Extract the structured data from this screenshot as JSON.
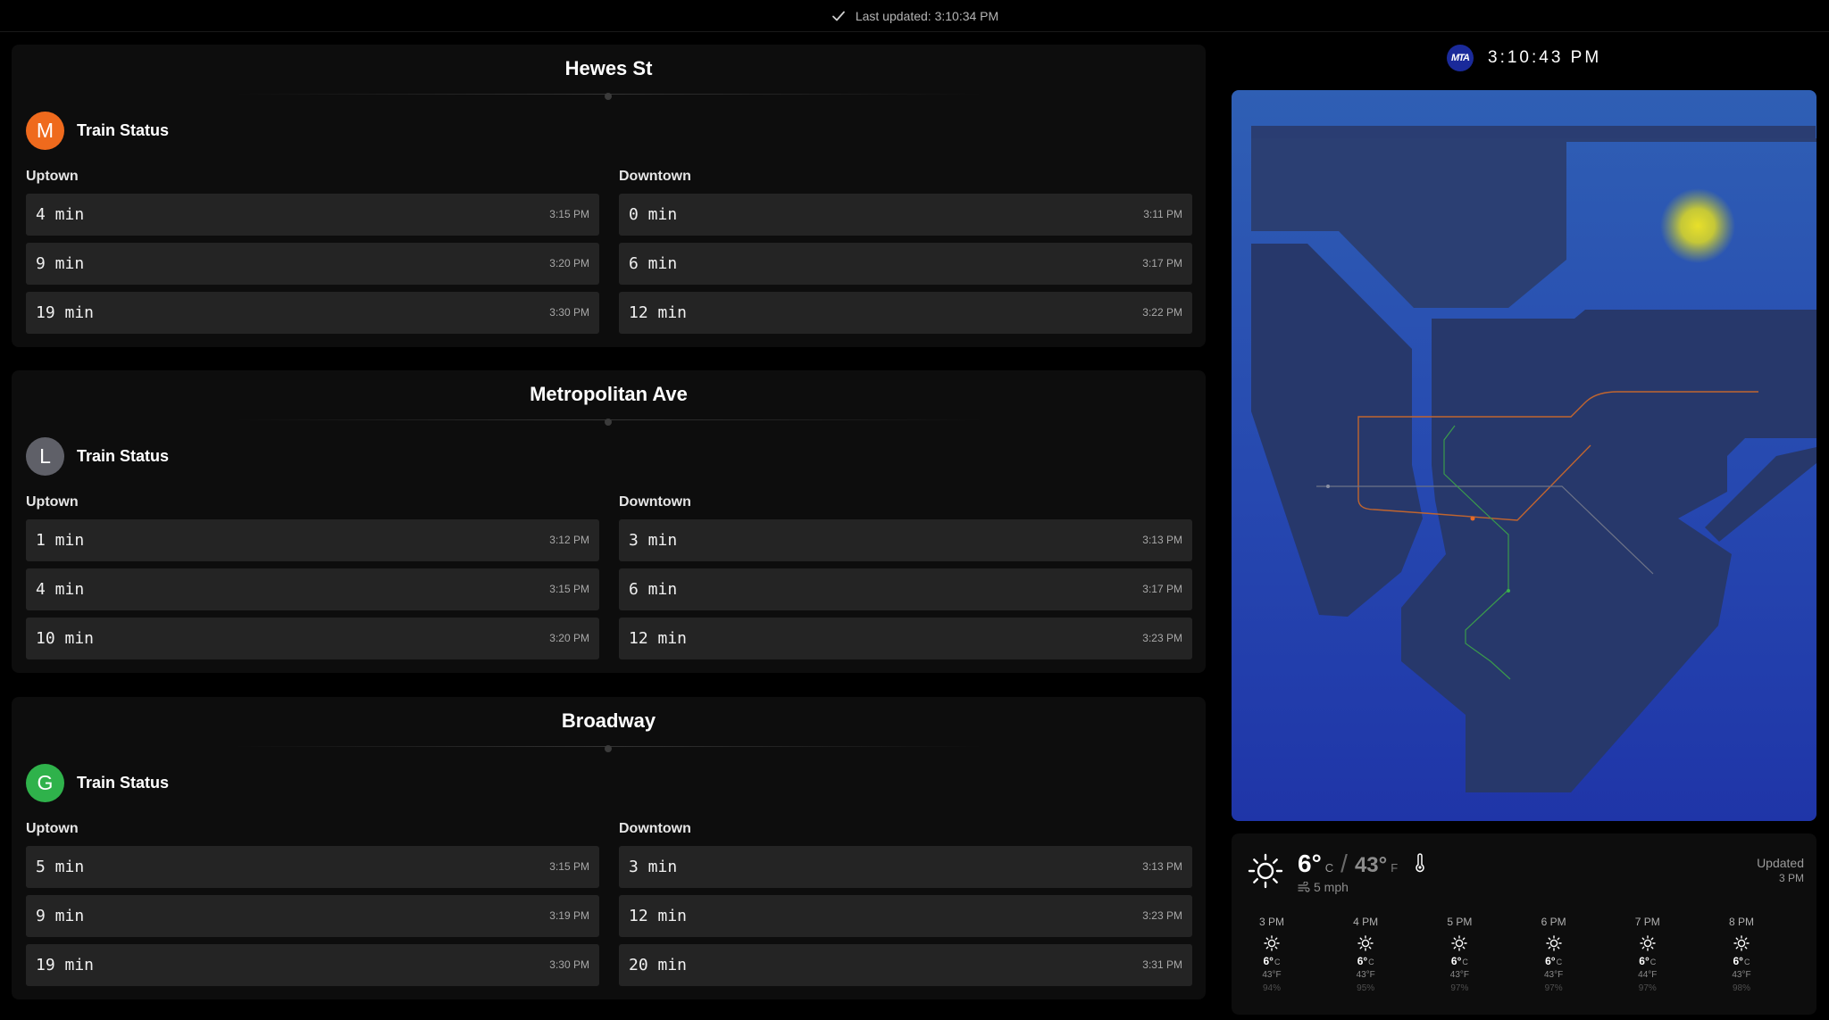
{
  "header": {
    "last_updated": "Last updated: 3:10:34 PM"
  },
  "clock": {
    "logo": "MTA",
    "time": "3:10:43 PM"
  },
  "stations": [
    {
      "name": "Hewes St",
      "line": "M",
      "line_color": "#ef6a1d",
      "status_label": "Train Status",
      "uptown_label": "Uptown",
      "downtown_label": "Downtown",
      "uptown": [
        {
          "mins": "4 min",
          "time": "3:15 PM"
        },
        {
          "mins": "9 min",
          "time": "3:20 PM"
        },
        {
          "mins": "19 min",
          "time": "3:30 PM"
        }
      ],
      "downtown": [
        {
          "mins": "0 min",
          "time": "3:11 PM"
        },
        {
          "mins": "6 min",
          "time": "3:17 PM"
        },
        {
          "mins": "12 min",
          "time": "3:22 PM"
        }
      ]
    },
    {
      "name": "Metropolitan Ave",
      "line": "L",
      "line_color": "#5f6068",
      "status_label": "Train Status",
      "uptown_label": "Uptown",
      "downtown_label": "Downtown",
      "uptown": [
        {
          "mins": "1 min",
          "time": "3:12 PM"
        },
        {
          "mins": "4 min",
          "time": "3:15 PM"
        },
        {
          "mins": "10 min",
          "time": "3:20 PM"
        }
      ],
      "downtown": [
        {
          "mins": "3 min",
          "time": "3:13 PM"
        },
        {
          "mins": "6 min",
          "time": "3:17 PM"
        },
        {
          "mins": "12 min",
          "time": "3:23 PM"
        }
      ]
    },
    {
      "name": "Broadway",
      "line": "G",
      "line_color": "#2fb24b",
      "status_label": "Train Status",
      "uptown_label": "Uptown",
      "downtown_label": "Downtown",
      "uptown": [
        {
          "mins": "5 min",
          "time": "3:15 PM"
        },
        {
          "mins": "9 min",
          "time": "3:19 PM"
        },
        {
          "mins": "19 min",
          "time": "3:30 PM"
        }
      ],
      "downtown": [
        {
          "mins": "3 min",
          "time": "3:13 PM"
        },
        {
          "mins": "12 min",
          "time": "3:23 PM"
        },
        {
          "mins": "20 min",
          "time": "3:31 PM"
        }
      ]
    }
  ],
  "map": {
    "land_color": "#28376a",
    "water_color": "#2d57b2",
    "sun_color": "#e8e02a"
  },
  "weather": {
    "icon": "sun-icon",
    "temp_c": "6°",
    "unit_c": "C",
    "slash": "/",
    "temp_f": "43°",
    "unit_f": "F",
    "wind": "5 mph",
    "updated_label": "Updated",
    "updated_time": "3 PM",
    "hourly": [
      {
        "hour": "3 PM",
        "c": "6°",
        "f": "43°F",
        "pct": "94%"
      },
      {
        "hour": "4 PM",
        "c": "6°",
        "f": "43°F",
        "pct": "95%"
      },
      {
        "hour": "5 PM",
        "c": "6°",
        "f": "43°F",
        "pct": "97%"
      },
      {
        "hour": "6 PM",
        "c": "6°",
        "f": "43°F",
        "pct": "97%"
      },
      {
        "hour": "7 PM",
        "c": "6°",
        "f": "44°F",
        "pct": "97%"
      },
      {
        "hour": "8 PM",
        "c": "6°",
        "f": "43°F",
        "pct": "98%"
      }
    ],
    "hour_unit": "C"
  }
}
